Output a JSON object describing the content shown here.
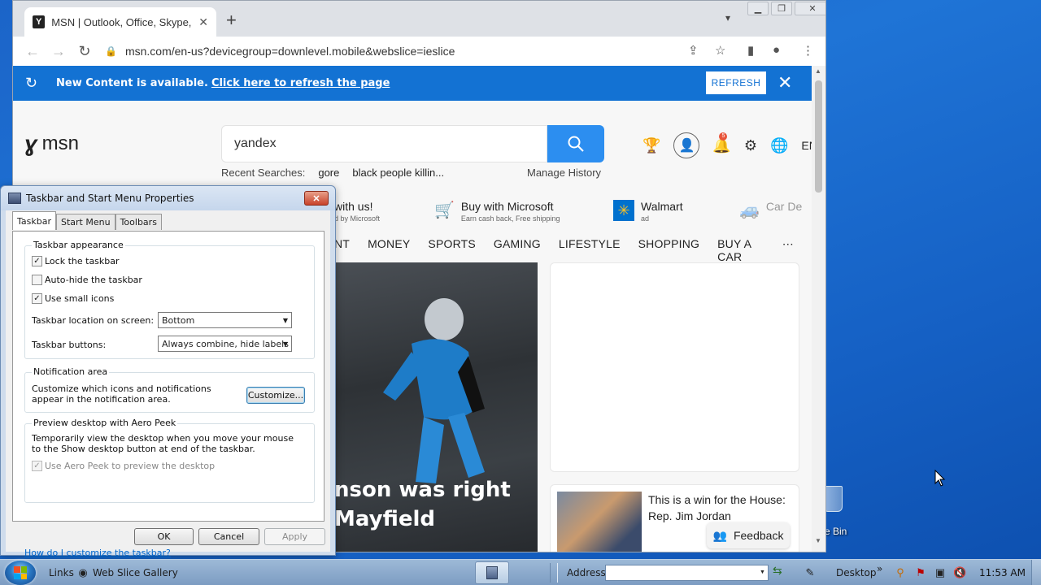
{
  "desktop": {
    "recycle_bin_label": "e Bin"
  },
  "browser": {
    "tab_title": "MSN | Outlook, Office, Skype, Bi",
    "url": "msn.com/en-us?devicegroup=downlevel.mobile&webslice=ieslice",
    "new_tab_symbol": "+",
    "back_icon": "arrow-left-icon",
    "forward_icon": "arrow-right-icon",
    "reload_icon": "reload-icon"
  },
  "banner": {
    "text": "New Content is available.",
    "link": "Click here to refresh the page",
    "button": "REFRESH",
    "color": "#1372d3"
  },
  "msn": {
    "logo_text": "msn",
    "search_value": "yandex",
    "recent_label": "Recent Searches:",
    "recent_terms": [
      "gore",
      "black people killin..."
    ],
    "manage_history": "Manage History",
    "lang": "EN",
    "notification_count": "5",
    "search_button_color": "#2c8ef0"
  },
  "promos": [
    {
      "title": "with us!",
      "sub": "d by Microsoft"
    },
    {
      "title": "Buy with Microsoft",
      "sub": "Earn cash back, Free shipping"
    },
    {
      "title": "Walmart",
      "sub": "ad"
    },
    {
      "title": "Car De",
      "sub": ""
    }
  ],
  "nav": [
    "NT",
    "MONEY",
    "SPORTS",
    "GAMING",
    "LIFESTYLE",
    "SHOPPING",
    "BUY A CAR",
    "⋯"
  ],
  "hero": {
    "line1": "nson was right",
    "line2": "Mayfield"
  },
  "news": {
    "title": "This is a win for the House: Rep. Jim Jordan"
  },
  "feedback_label": "Feedback",
  "dialog": {
    "title": "Taskbar and Start Menu Properties",
    "tabs": [
      "Taskbar",
      "Start Menu",
      "Toolbars"
    ],
    "appearance_title": "Taskbar appearance",
    "lock_label": "Lock the taskbar",
    "autohide_label": "Auto-hide the taskbar",
    "small_icons_label": "Use small icons",
    "location_label": "Taskbar location on screen:",
    "location_value": "Bottom",
    "buttons_label": "Taskbar buttons:",
    "buttons_value": "Always combine, hide labels",
    "notif_title": "Notification area",
    "notif_desc": "Customize which icons and notifications appear in the notification area.",
    "customize_btn": "Customize...",
    "peek_title": "Preview desktop with Aero Peek",
    "peek_desc": "Temporarily view the desktop when you move your mouse to the Show desktop button at end of the taskbar.",
    "peek_label": "Use Aero Peek to preview the desktop",
    "help_link": "How do I customize the taskbar?",
    "ok": "OK",
    "cancel": "Cancel",
    "apply": "Apply"
  },
  "taskbar": {
    "links_label": "Links",
    "web_slice": "Web Slice Gallery",
    "address_label": "Address",
    "desktop_label": "Desktop",
    "chevron": "»",
    "clock": "11:53 AM"
  }
}
